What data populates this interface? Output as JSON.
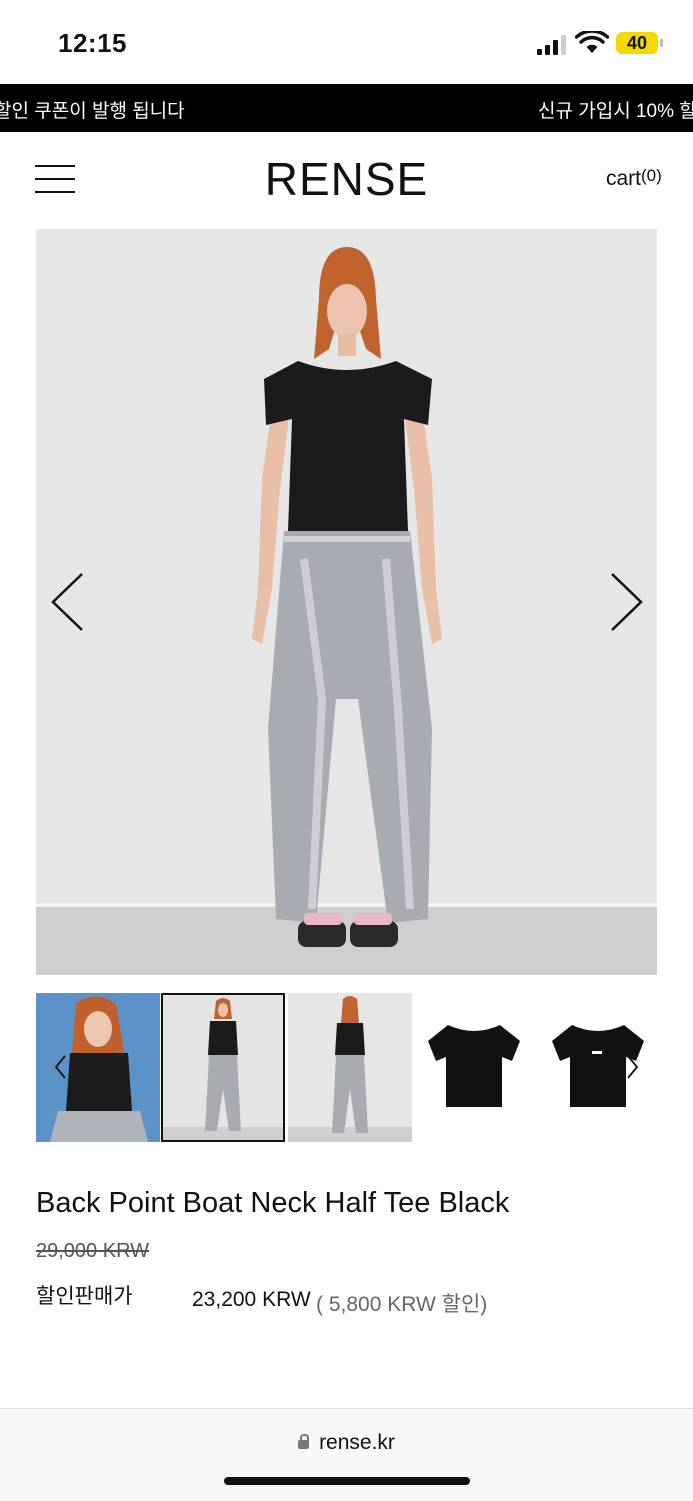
{
  "status": {
    "time": "12:15",
    "battery": "40"
  },
  "marquee": {
    "text_left": "할인 쿠폰이 발행 됩니다",
    "text_right": "신규 가입시 10% 할"
  },
  "header": {
    "logo": "RENSE",
    "cart_label": "cart",
    "cart_count": "(0)"
  },
  "hero": {
    "icons": [
      "chevron-left-icon",
      "chevron-right-icon"
    ]
  },
  "thumbnails": {
    "count": 5,
    "active_index": 1
  },
  "product": {
    "title": "Back Point Boat Neck Half Tee Black",
    "original_price": "29,000 KRW",
    "sale_label": "할인판매가",
    "sale_price": "23,200 KRW",
    "discount": "( 5,800 KRW 할인)"
  },
  "browser": {
    "url": "rense.kr"
  },
  "colors": {
    "marquee_bg": "#000000",
    "battery": "#f5d800"
  }
}
